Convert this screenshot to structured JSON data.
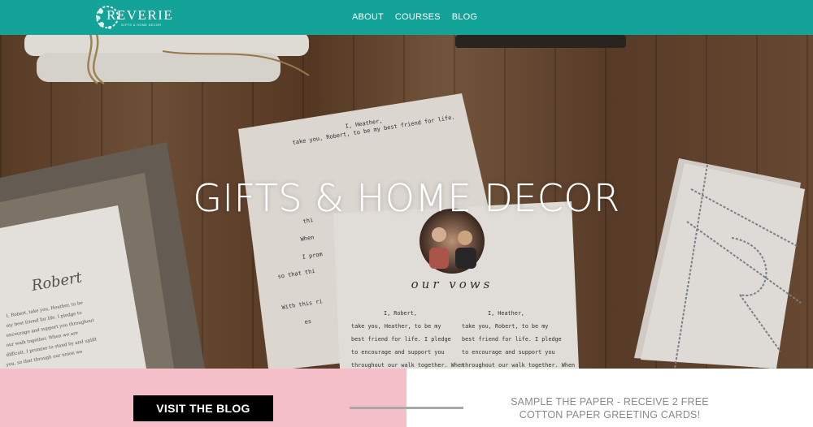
{
  "header": {
    "logo_name": "REVERIE",
    "logo_tagline": "GIFTS & HOME DECOR",
    "nav": [
      "ABOUT",
      "COURSES",
      "BLOG"
    ]
  },
  "hero": {
    "title": "GIFTS & HOME DECOR",
    "vow_card": {
      "heading": "our vows",
      "left_column": [
        "I, Robert,",
        "take you, Heather, to be my",
        "best friend for life. I pledge",
        "to encourage and support you",
        "throughout our walk together. When"
      ],
      "right_column": [
        "I, Heather,",
        "take you, Robert, to be my",
        "best friend for life. I pledge",
        "to encourage and support you",
        "throughout our walk together. When"
      ]
    },
    "back_card": {
      "lines": [
        "I, Heather,",
        "take you, Robert, to be my best friend for life.",
        "thi",
        "When",
        "I prom",
        "so that thi",
        "With this ri",
        "es"
      ]
    },
    "frame_card": {
      "name": "Robert",
      "lines": [
        "I, Robert, take you, Heather, to be",
        "my best friend for life. I pledge to",
        "encourage and support you throughout",
        "our walk together. When we are",
        "difficult, I promise to stand by and uplift",
        "you, so that through our union we",
        "can accomplish more than we could alone."
      ]
    }
  },
  "bottom": {
    "blog_button": "VISIT THE BLOG",
    "promo_line1": "SAMPLE THE PAPER - RECEIVE 2 FREE",
    "promo_line2": "COTTON PAPER GREETING CARDS!"
  },
  "colors": {
    "header_bg": "#14a398",
    "panel_pink": "#f4bfc8",
    "button_bg": "#000000",
    "promo_text": "#8a8a8a"
  }
}
